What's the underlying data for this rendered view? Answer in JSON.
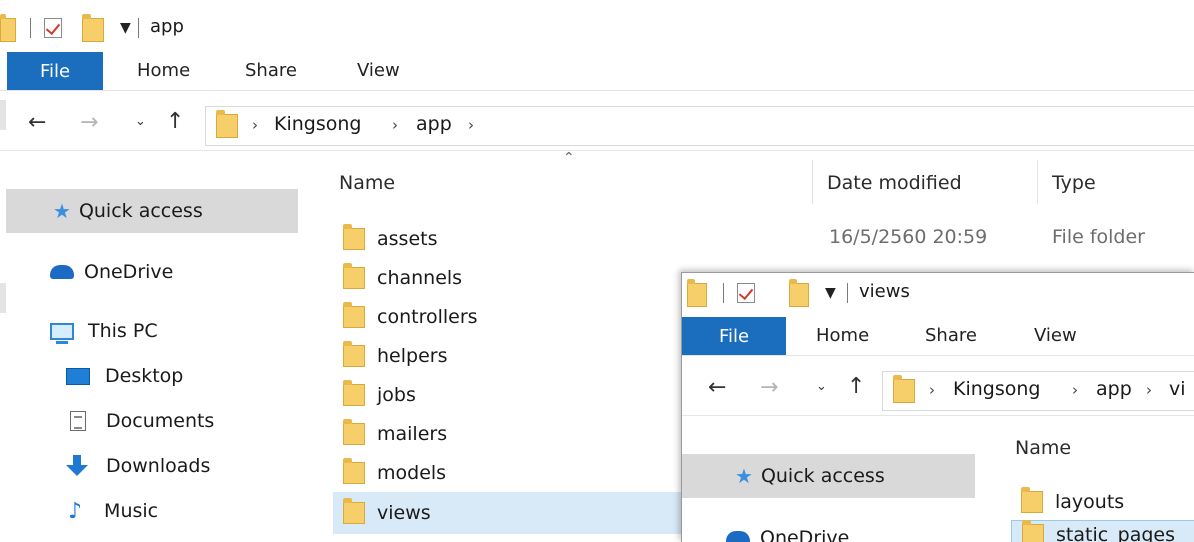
{
  "main_window": {
    "title": "app",
    "ribbon_tabs": [
      "File",
      "Home",
      "Share",
      "View"
    ],
    "breadcrumb": [
      "Kingsong",
      "app"
    ],
    "nav": {
      "quick_access": "Quick access",
      "onedrive": "OneDrive",
      "this_pc": "This PC",
      "desktop": "Desktop",
      "documents": "Documents",
      "downloads": "Downloads",
      "music": "Music"
    },
    "columns": {
      "name": "Name",
      "date": "Date modified",
      "type": "Type"
    },
    "items": [
      {
        "name": "assets",
        "date": "16/5/2560 20:59",
        "type": "File folder"
      },
      {
        "name": "channels",
        "date": "",
        "type": ""
      },
      {
        "name": "controllers",
        "date": "",
        "type": ""
      },
      {
        "name": "helpers",
        "date": "",
        "type": ""
      },
      {
        "name": "jobs",
        "date": "",
        "type": ""
      },
      {
        "name": "mailers",
        "date": "",
        "type": ""
      },
      {
        "name": "models",
        "date": "",
        "type": ""
      },
      {
        "name": "views",
        "date": "",
        "type": ""
      }
    ],
    "selected_item": "views"
  },
  "second_window": {
    "title": "views",
    "ribbon_tabs": [
      "File",
      "Home",
      "Share",
      "View"
    ],
    "breadcrumb": [
      "Kingsong",
      "app",
      "vi"
    ],
    "nav": {
      "quick_access": "Quick access",
      "onedrive": "OneDrive"
    },
    "columns": {
      "name": "Name"
    },
    "items": [
      {
        "name": "layouts"
      },
      {
        "name": "static_pages"
      }
    ],
    "selected_item": "static_pages"
  },
  "colors": {
    "file_tab": "#1a6ebd",
    "selection": "#d8e9f7",
    "nav_selection": "#d9d9d9",
    "folder": "#f6cf6a"
  }
}
